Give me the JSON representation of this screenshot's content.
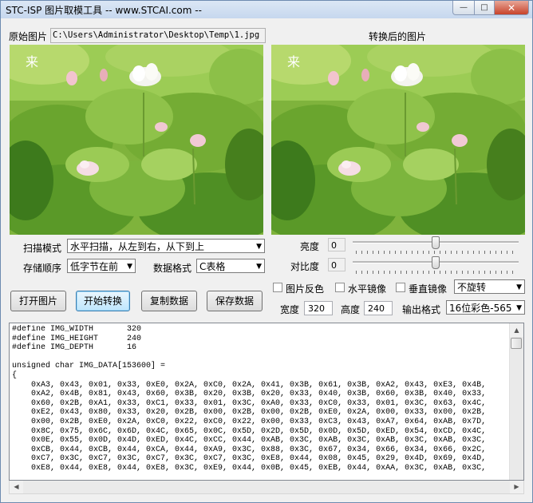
{
  "window": {
    "title": "STC-ISP 图片取模工具 -- www.STCAI.com --"
  },
  "labels": {
    "original_image": "原始图片",
    "converted_image": "转换后的图片",
    "scan_mode": "扫描模式",
    "storage_order": "存储顺序",
    "data_format": "数据格式",
    "brightness": "亮度",
    "contrast": "对比度",
    "width": "宽度",
    "height": "高度",
    "output_format": "输出格式"
  },
  "file_path": "C:\\Users\\Administrator\\Desktop\\Temp\\1.jpg",
  "image_watermark": "来",
  "selects": {
    "scan_mode": "水平扫描，从左到右，从下到上",
    "storage_order": "低字节在前",
    "data_format": "C表格",
    "rotation": "不旋转",
    "output_format": "16位彩色-565"
  },
  "values": {
    "brightness": "0",
    "contrast": "0",
    "width": "320",
    "height": "240",
    "brightness_level": 0,
    "contrast_level": 0
  },
  "buttons": {
    "open_image": "打开图片",
    "start_convert": "开始转换",
    "copy_data": "复制数据",
    "save_data": "保存数据"
  },
  "checkboxes": {
    "invert": "图片反色",
    "mirror_h": "水平镜像",
    "mirror_v": "垂直镜像"
  },
  "code_output": "#define IMG_WIDTH       320\n#define IMG_HEIGHT      240\n#define IMG_DEPTH       16\n\nunsigned char IMG_DATA[153600] =\n{\n    0xA3, 0x43, 0x01, 0x33, 0xE0, 0x2A, 0xC0, 0x2A, 0x41, 0x3B, 0x61, 0x3B, 0xA2, 0x43, 0xE3, 0x4B,\n    0xA2, 0x4B, 0x81, 0x43, 0x60, 0x3B, 0x20, 0x3B, 0x20, 0x33, 0x40, 0x3B, 0x60, 0x3B, 0x40, 0x33,\n    0x60, 0x2B, 0xA1, 0x33, 0xC1, 0x33, 0x01, 0x3C, 0xA0, 0x33, 0xC0, 0x33, 0x01, 0x3C, 0x63, 0x4C,\n    0xE2, 0x43, 0x80, 0x33, 0x20, 0x2B, 0x00, 0x2B, 0x00, 0x2B, 0xE0, 0x2A, 0x00, 0x33, 0x00, 0x2B,\n    0x00, 0x2B, 0xE0, 0x2A, 0xC0, 0x22, 0xC0, 0x22, 0x00, 0x33, 0xC3, 0x43, 0xA7, 0x64, 0xAB, 0x7D,\n    0x8C, 0x75, 0x6C, 0x6D, 0x4C, 0x65, 0x0C, 0x5D, 0x2D, 0x5D, 0x0D, 0x5D, 0xED, 0x54, 0xCD, 0x4C,\n    0x0E, 0x55, 0x0D, 0x4D, 0xED, 0x4C, 0xCC, 0x44, 0xAB, 0x3C, 0xAB, 0x3C, 0xAB, 0x3C, 0xAB, 0x3C,\n    0xCB, 0x44, 0xCB, 0x44, 0xCA, 0x44, 0xA9, 0x3C, 0x88, 0x3C, 0x67, 0x34, 0x66, 0x34, 0x66, 0x2C,\n    0xC7, 0x3C, 0xC7, 0x3C, 0xC7, 0x3C, 0xC7, 0x3C, 0xE8, 0x44, 0x08, 0x45, 0x29, 0x4D, 0x69, 0x4D,\n    0xE8, 0x44, 0xE8, 0x44, 0xE8, 0x3C, 0xE9, 0x44, 0x0B, 0x45, 0xEB, 0x44, 0xAA, 0x3C, 0xAB, 0x3C,"
}
